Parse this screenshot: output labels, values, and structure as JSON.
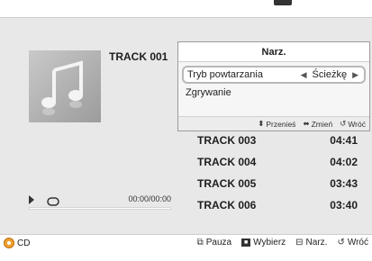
{
  "now_playing": {
    "title": "TRACK 001",
    "time": "00:00/00:00",
    "progress_percent": 0
  },
  "tracks": [
    {
      "name": "TRACK 003",
      "duration": "04:41"
    },
    {
      "name": "TRACK 004",
      "duration": "04:02"
    },
    {
      "name": "TRACK 005",
      "duration": "03:43"
    },
    {
      "name": "TRACK 006",
      "duration": "03:40"
    }
  ],
  "popup": {
    "title": "Narz.",
    "items": [
      {
        "label": "Tryb powtarzania",
        "value": "Ścieżkę"
      },
      {
        "label": "Zgrywanie"
      }
    ],
    "hints": {
      "move": "Przenieś",
      "change": "Zmień",
      "back": "Wróć"
    }
  },
  "footer": {
    "source": "CD",
    "pause": "Pauza",
    "select": "Wybierz",
    "tools": "Narz.",
    "back": "Wróć"
  },
  "icons": {
    "album": "music-note-icon",
    "play": "play-icon",
    "repeat": "repeat-icon",
    "cd": "cd-icon"
  },
  "colors": {
    "background": "#e8e8e8",
    "popup": "#f6f6f6",
    "text": "#1e1e1e",
    "cd_accent": "#f0a030"
  }
}
